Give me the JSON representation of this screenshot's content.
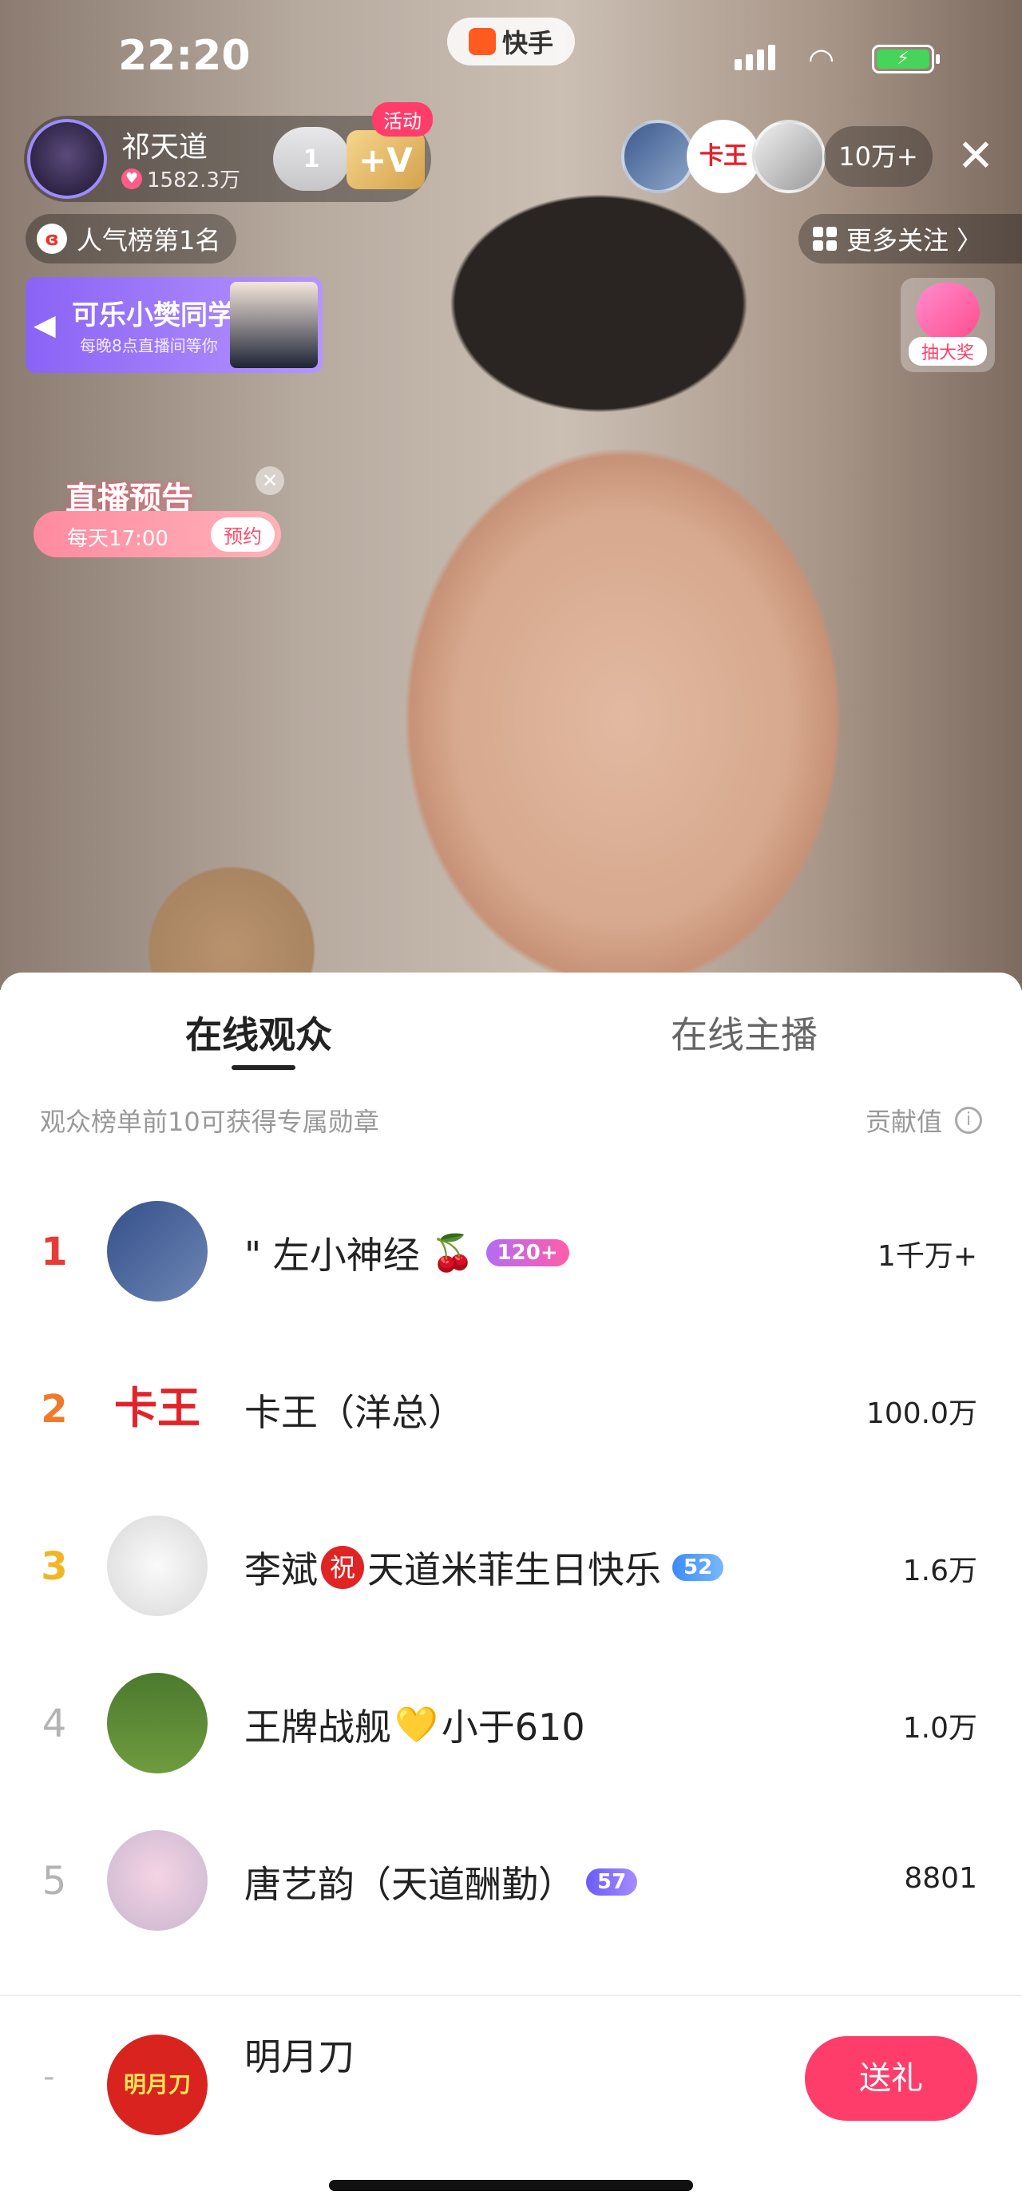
{
  "status": {
    "time": "22:20",
    "app_name": "快手"
  },
  "host": {
    "name": "祁天道",
    "likes": "1582.3万",
    "fans_level": "1",
    "v_badge": "+V",
    "activity_tag": "活动"
  },
  "viewers": {
    "top_avatar_2_text": "卡王",
    "count": "10万+"
  },
  "rank_pill": {
    "label": "人气榜第1名"
  },
  "more_follow": {
    "label": "更多关注 〉"
  },
  "promo": {
    "title": "可乐小樊同学",
    "subtitle": "每晚8点直播间等你"
  },
  "lottery": {
    "label": "抽大奖"
  },
  "preview": {
    "title": "直播预告",
    "time": "每天17:00",
    "button": "预约"
  },
  "tabs": {
    "active": "在线观众",
    "inactive": "在线主播"
  },
  "list_header": {
    "left": "观众榜单前10可获得专属勋章",
    "right": "贡献值"
  },
  "rows": [
    {
      "rank": "1",
      "name": "\" 左小神经",
      "emoji": "🍒",
      "badge": "120+",
      "value": "1千万+"
    },
    {
      "rank": "2",
      "name": "卡王（洋总）",
      "avatar_text": "卡王",
      "value": "100.0万"
    },
    {
      "rank": "3",
      "name_a": "李斌",
      "bless": "祝",
      "name_b": "天道米菲生日快乐",
      "badge": "52",
      "value": "1.6万"
    },
    {
      "rank": "4",
      "name_a": "王牌战舰",
      "emoji": "💛",
      "name_b": "小于610",
      "value": "1.0万"
    },
    {
      "rank": "5",
      "name": "唐艺韵（天道酬勤）",
      "badge": "57",
      "value": "8801"
    }
  ],
  "footer": {
    "rank": "-",
    "avatar_text": "明月刀",
    "name": "明月刀",
    "gift_button": "送礼"
  }
}
